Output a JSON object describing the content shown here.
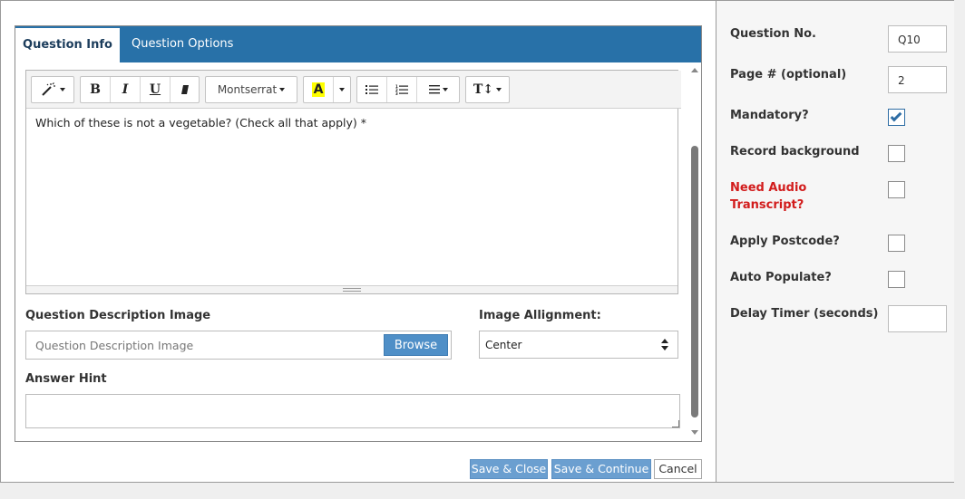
{
  "tabs": [
    {
      "label": "Question Info",
      "active": true
    },
    {
      "label": "Question Options",
      "active": false
    }
  ],
  "toolbar": {
    "magic_icon": "magic-wand-icon",
    "bold": "B",
    "italic": "I",
    "underline": "U",
    "eraser_icon": "eraser-icon",
    "font": "Montserrat",
    "highlight": "A",
    "unordered_list_icon": "unordered-list-icon",
    "ordered_list_icon": "ordered-list-icon",
    "align_icon": "align-left-icon",
    "text_size": "T↕"
  },
  "editor": {
    "content": "Which of these is not a vegetable? (Check all that apply) *"
  },
  "description_image": {
    "label": "Question Description Image",
    "placeholder": "Question Description Image",
    "browse": "Browse"
  },
  "alignment": {
    "label": "Image Allignment:",
    "value": "Center"
  },
  "answer_hint": {
    "label": "Answer Hint",
    "value": ""
  },
  "buttons": {
    "save_close": "Save & Close",
    "save_continue": "Save & Continue",
    "cancel": "Cancel"
  },
  "settings": {
    "question_no": {
      "label": "Question No.",
      "value": "Q10"
    },
    "page": {
      "label": "Page # (optional)",
      "value": "2"
    },
    "mandatory": {
      "label": "Mandatory?",
      "checked": true
    },
    "record_background": {
      "label": "Record background",
      "checked": false
    },
    "audio_transcript": {
      "label_line1": "Need Audio",
      "label_line2": "Transcript?",
      "checked": false,
      "color": "#d21c1c"
    },
    "apply_postcode": {
      "label": "Apply Postcode?",
      "checked": false
    },
    "auto_populate": {
      "label": "Auto Populate?",
      "checked": false
    },
    "delay_timer": {
      "label": "Delay Timer (seconds)",
      "value": ""
    }
  },
  "colors": {
    "tab_bar": "#2871a8",
    "primary_button": "#6b9fd0",
    "browse_button": "#4f8fc7",
    "checkbox_checked": "#2e6da4"
  }
}
